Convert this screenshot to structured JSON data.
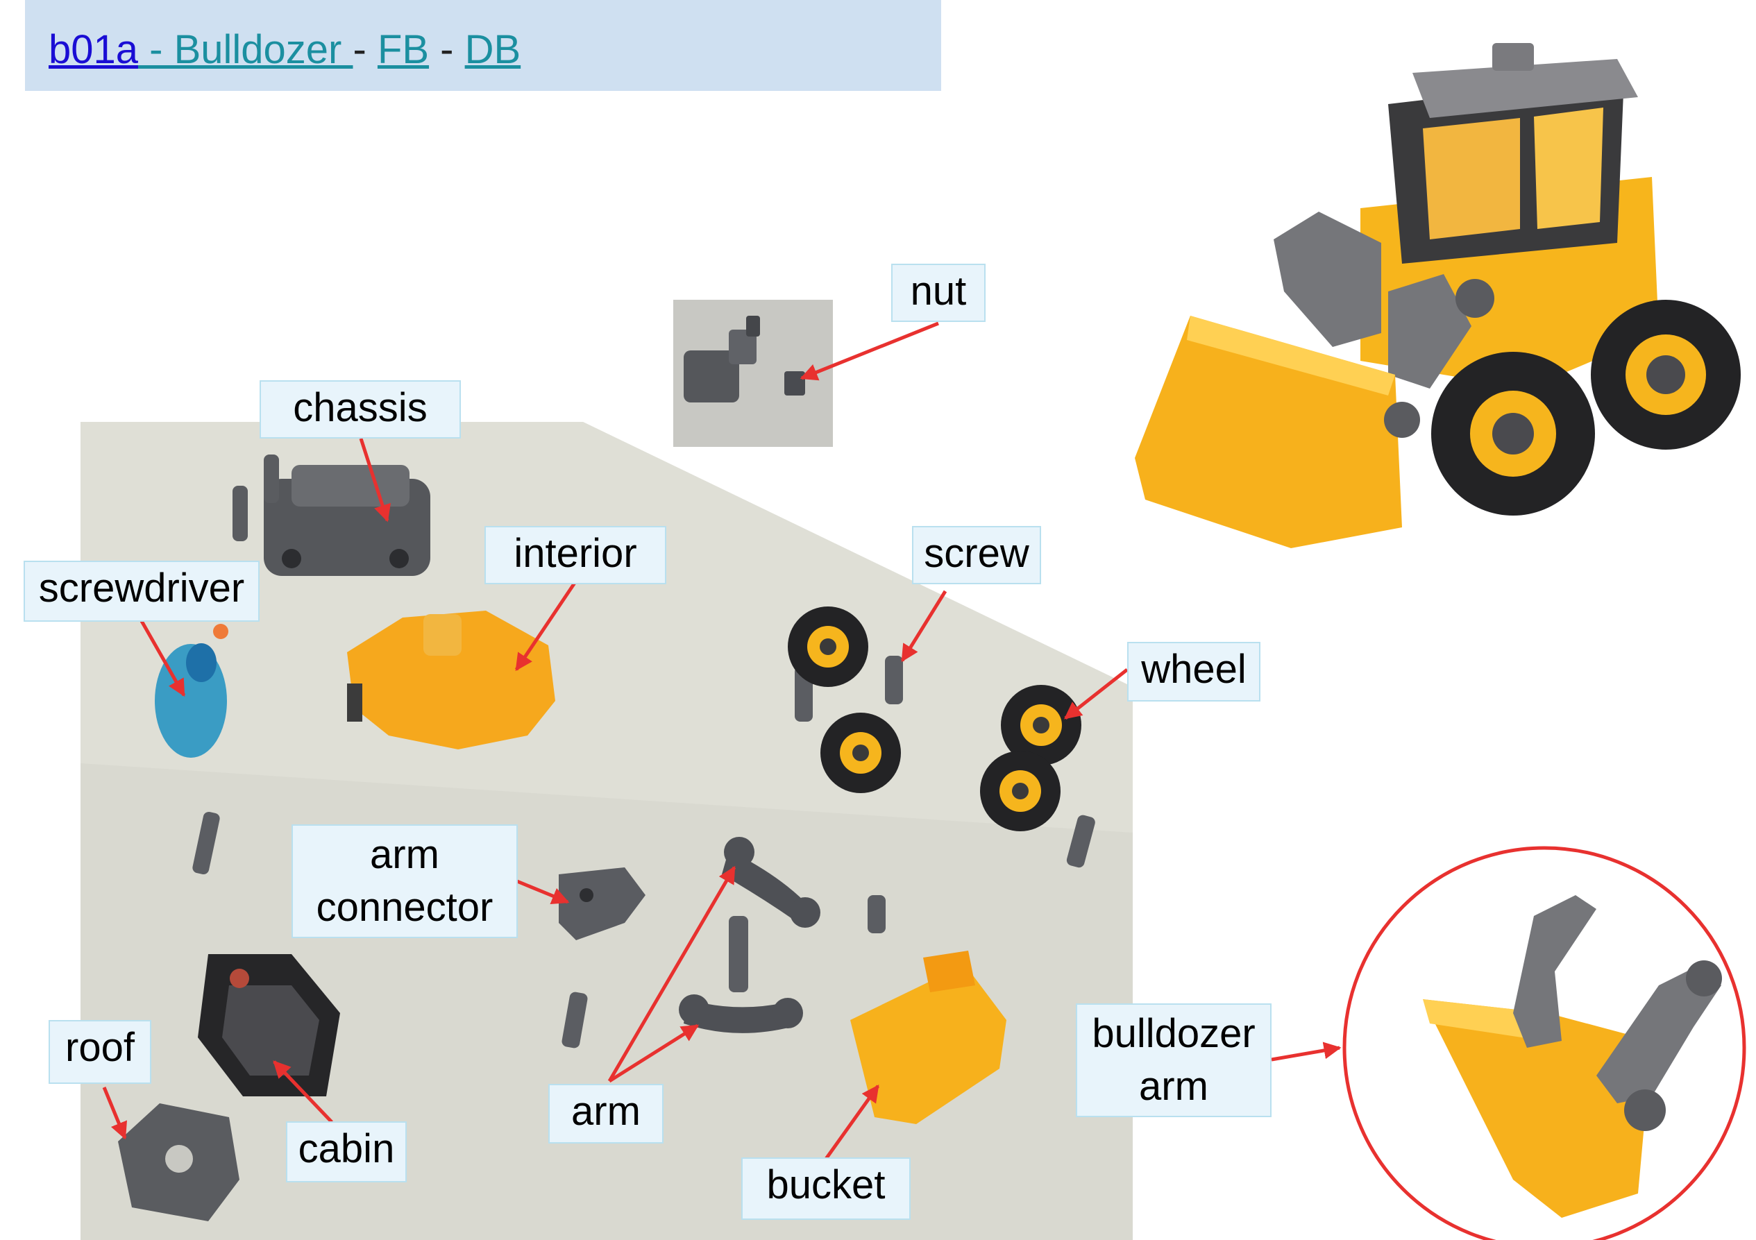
{
  "header": {
    "code_link": "b01a",
    "title_link": " -  Bulldozer ",
    "sep1": " - ",
    "fb_link": "FB",
    "sep2": "   - ",
    "db_link": "DB"
  },
  "labels": {
    "nut": "nut",
    "chassis": "chassis",
    "interior": "interior",
    "screw": "screw",
    "screwdriver": "screwdriver",
    "wheel": "wheel",
    "arm_connector_line1": "arm",
    "arm_connector_line2": "connector",
    "roof": "roof",
    "cabin": "cabin",
    "arm": "arm",
    "bucket": "bucket",
    "bulldozer_arm_line1": "bulldozer",
    "bulldozer_arm_line2": "arm"
  },
  "colors": {
    "header_bg": "#cfe0f1",
    "label_bg": "#e8f4fb",
    "label_border": "#b9e0ef",
    "arrow": "#e8312f",
    "toy_yellow": "#f7b51c",
    "toy_gray": "#6f6f73",
    "toy_black": "#2b2b2b",
    "mat": "#dcdcd4"
  }
}
